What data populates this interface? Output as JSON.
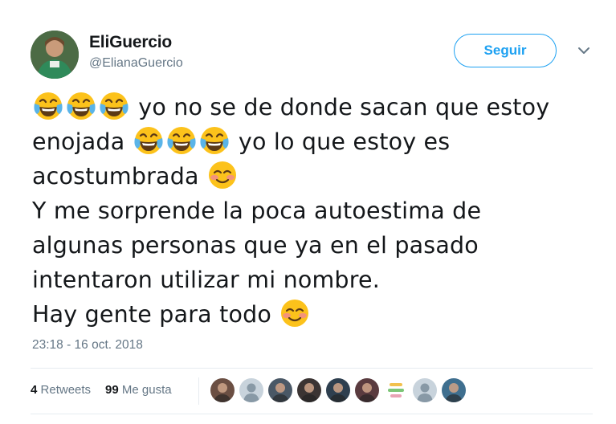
{
  "user": {
    "display_name": "EliGuercio",
    "handle": "@ElianaGuercio",
    "avatar_icon": "profile-photo"
  },
  "follow_button": {
    "label": "Seguir"
  },
  "menu": {
    "icon": "chevron-down-icon"
  },
  "tweet": {
    "lines": [
      {
        "emoji_before": [
          "laugh-cry",
          "laugh-cry",
          "laugh-cry"
        ],
        "text": " yo no se de donde sacan que estoy",
        "emoji_after": [],
        "text_after": ""
      },
      {
        "emoji_before": [],
        "text": "enojada ",
        "emoji_after": [
          "laugh-cry",
          "laugh-cry",
          "laugh-cry"
        ],
        "text_after": " yo lo que estoy es"
      },
      {
        "emoji_before": [],
        "text": "acostumbrada ",
        "emoji_after": [
          "smiling-blush"
        ],
        "text_after": ""
      },
      {
        "emoji_before": [],
        "text": "Y me sorprende la poca autoestima de",
        "emoji_after": [],
        "text_after": ""
      },
      {
        "emoji_before": [],
        "text": "algunas personas que ya en el pasado",
        "emoji_after": [],
        "text_after": ""
      },
      {
        "emoji_before": [],
        "text": "intentaron utilizar mi nombre.",
        "emoji_after": [],
        "text_after": ""
      },
      {
        "emoji_before": [],
        "text": "Hay gente para todo ",
        "emoji_after": [
          "smiling-blush"
        ],
        "text_after": ""
      }
    ],
    "timestamp": "23:18 - 16 oct. 2018"
  },
  "stats": {
    "retweets_count": "4",
    "retweets_label": "Retweets",
    "likes_count": "99",
    "likes_label": "Me gusta"
  },
  "likers": [
    {
      "kind": "photo",
      "color": "#6b4f43"
    },
    {
      "kind": "default",
      "color": "#c8d3dc"
    },
    {
      "kind": "photo",
      "color": "#4a5866"
    },
    {
      "kind": "photo",
      "color": "#3b3433"
    },
    {
      "kind": "photo",
      "color": "#2e3f4f"
    },
    {
      "kind": "photo",
      "color": "#5a3b3f"
    },
    {
      "kind": "sticker",
      "color": "#f2c14e"
    },
    {
      "kind": "default",
      "color": "#c8d3dc"
    },
    {
      "kind": "photo",
      "color": "#3f6f8f"
    }
  ],
  "colors": {
    "accent": "#1da1f2",
    "secondary_text": "#657786",
    "divider": "#e6ecf0"
  }
}
